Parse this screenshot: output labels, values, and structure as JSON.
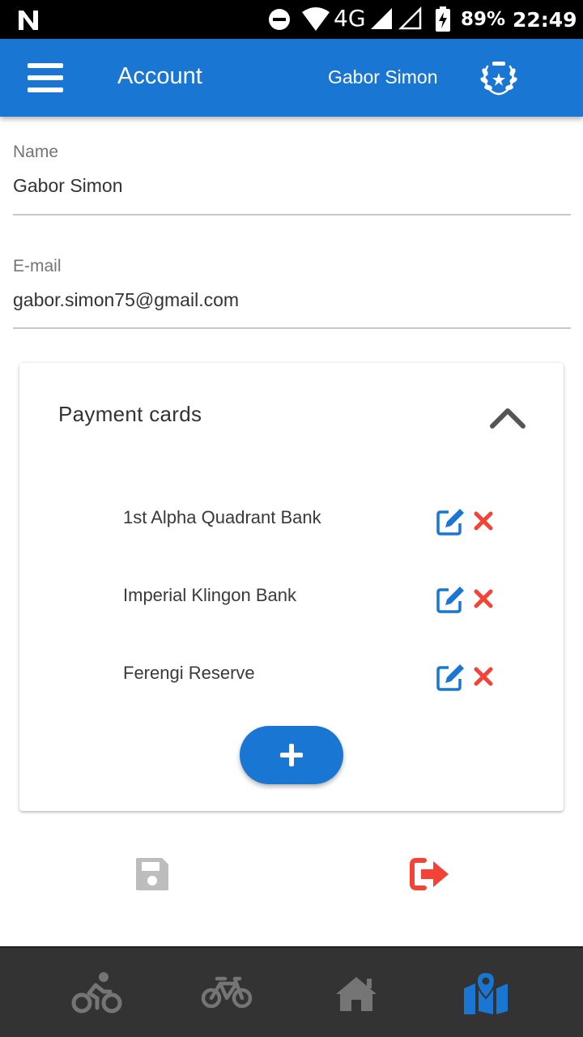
{
  "status_bar": {
    "network": "4G",
    "battery": "89%",
    "time": "22:49"
  },
  "app_bar": {
    "title": "Account",
    "user_name": "Gabor Simon"
  },
  "form": {
    "name_label": "Name",
    "name_value": "Gabor Simon",
    "email_label": "E-mail",
    "email_value": "gabor.simon75@gmail.com"
  },
  "payment_cards": {
    "title": "Payment cards",
    "items": [
      {
        "name": "1st Alpha Quadrant Bank"
      },
      {
        "name": "Imperial Klingon Bank"
      },
      {
        "name": "Ferengi Reserve"
      }
    ]
  },
  "actions": {
    "save_icon": "floppy-disk-icon",
    "logout_icon": "sign-out-icon"
  },
  "bottom_nav": [
    {
      "icon": "bicycle-rider-icon",
      "active": false
    },
    {
      "icon": "bicycle-icon",
      "active": false
    },
    {
      "icon": "home-icon",
      "active": false
    },
    {
      "icon": "map-marker-icon",
      "active": true
    }
  ],
  "colors": {
    "primary": "#1976d2",
    "delete": "#f44336",
    "logout": "#f44336",
    "nav_bg": "#333333",
    "nav_inactive": "#757575",
    "save_disabled": "#bdbdbd"
  }
}
